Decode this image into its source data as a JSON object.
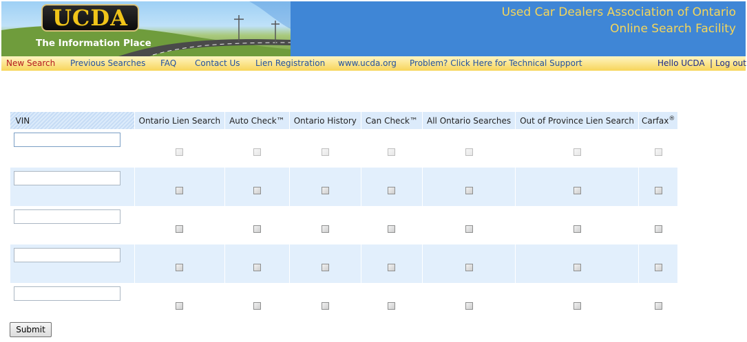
{
  "header": {
    "logo_text": "UCDA",
    "tagline": "The Information Place",
    "title_line1": "Used Car Dealers Association of Ontario",
    "title_line2": "Online Search Facility"
  },
  "nav": {
    "items": [
      {
        "label": "New Search",
        "active": true
      },
      {
        "label": "Previous Searches",
        "active": false
      },
      {
        "label": "FAQ",
        "active": false
      },
      {
        "label": "Contact Us",
        "active": false
      },
      {
        "label": "Lien Registration",
        "active": false
      },
      {
        "label": "www.ucda.org",
        "active": false
      },
      {
        "label": "Problem? Click Here for Technical Support",
        "active": false
      }
    ],
    "hello": "Hello UCDA",
    "separator": "|",
    "logout": "Log out"
  },
  "search_table": {
    "columns": [
      "VIN",
      "Ontario Lien Search",
      "Auto Check™",
      "Ontario History",
      "Can Check™",
      "All Ontario Searches",
      "Out of Province Lien Search",
      "Carfax"
    ],
    "carfax_mark": "®",
    "rows": [
      {
        "vin": "",
        "checks": [
          false,
          false,
          false,
          false,
          false,
          false,
          false
        ],
        "focused": true
      },
      {
        "vin": "",
        "checks": [
          false,
          false,
          false,
          false,
          false,
          false,
          false
        ]
      },
      {
        "vin": "",
        "checks": [
          false,
          false,
          false,
          false,
          false,
          false,
          false
        ]
      },
      {
        "vin": "",
        "checks": [
          false,
          false,
          false,
          false,
          false,
          false,
          false
        ]
      },
      {
        "vin": "",
        "checks": [
          false,
          false,
          false,
          false,
          false,
          false,
          false
        ]
      }
    ]
  },
  "submit_label": "Submit",
  "colors": {
    "header_blue": "#3f86d6",
    "title_gold": "#f5d65a",
    "nav_yellow": "#f7d55a",
    "active_link": "#b4191e",
    "link_blue": "#2352a0",
    "row_alt": "#e2effc"
  }
}
